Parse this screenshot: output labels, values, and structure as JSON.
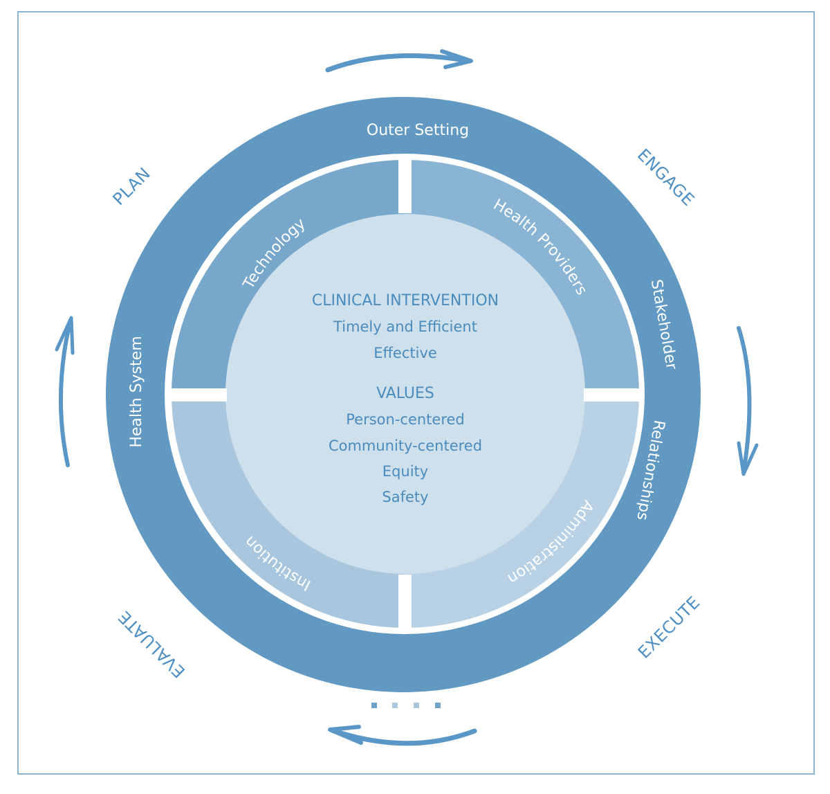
{
  "colors": {
    "outer_ring": "#6199c2",
    "quad_top_left": "#77a7cb",
    "quad_top_right": "#8ab4d4",
    "quad_bottom_left": "#a8c7de",
    "quad_bottom_right": "#b9d1e4",
    "center_disk": "#cfe0ed",
    "text_blue": "#4a8bbd",
    "arrow": "#5a97c6",
    "frame_border": "#8ab4d4"
  },
  "outer_ring": {
    "top_label": "Outer Setting",
    "left_label": "Health System",
    "right_label_1": "Stakeholder",
    "right_label_2": "Relationships"
  },
  "quadrants": {
    "top_left": "Technology",
    "top_right": "Health Providers",
    "bottom_left": "Institution",
    "bottom_right": "Administration"
  },
  "center": {
    "heading_1": "CLINICAL INTERVENTION",
    "items_1": [
      "Timely and Efficient",
      "Effective"
    ],
    "heading_2": "VALUES",
    "items_2": [
      "Person-centered",
      "Community-centered",
      "Equity",
      "Safety"
    ]
  },
  "phases": {
    "plan": "PLAN",
    "engage": "ENGAGE",
    "execute": "EXECUTE",
    "evaluate": "EVALUATE"
  },
  "cycle_arrows": [
    "arrow-right-top",
    "arrow-down-right",
    "arrow-left-bottom",
    "arrow-up-left"
  ],
  "dots": {
    "colors": [
      "#6fa2c9",
      "#a9c8df",
      "#a9c8df",
      "#6fa2c9"
    ]
  }
}
